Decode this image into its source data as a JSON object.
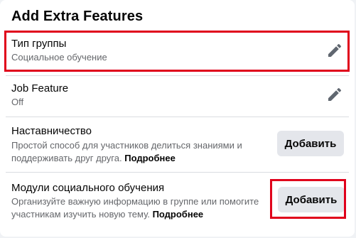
{
  "panel": {
    "title": "Add Extra Features"
  },
  "features": [
    {
      "title": "Тип группы",
      "subtitle": "Социальное обучение",
      "action": "edit-icon"
    },
    {
      "title": "Job Feature",
      "subtitle": "Off",
      "action": "edit-icon"
    },
    {
      "title": "Наставничество",
      "description_line1": "Простой способ для участников делиться знаниями и",
      "description_line2": "поддерживать друг друга.",
      "more_link": "Подробнее",
      "button_label": "Добавить"
    },
    {
      "title": "Модули социального обучения",
      "description_line1": "Организуйте важную информацию в группе или помогите",
      "description_line2": "участникам изучить новую тему.",
      "more_link": "Подробнее",
      "button_label": "Добавить"
    }
  ],
  "colors": {
    "highlight": "#e0001b",
    "button_bg": "#e4e6eb",
    "secondary_text": "#65676b"
  }
}
